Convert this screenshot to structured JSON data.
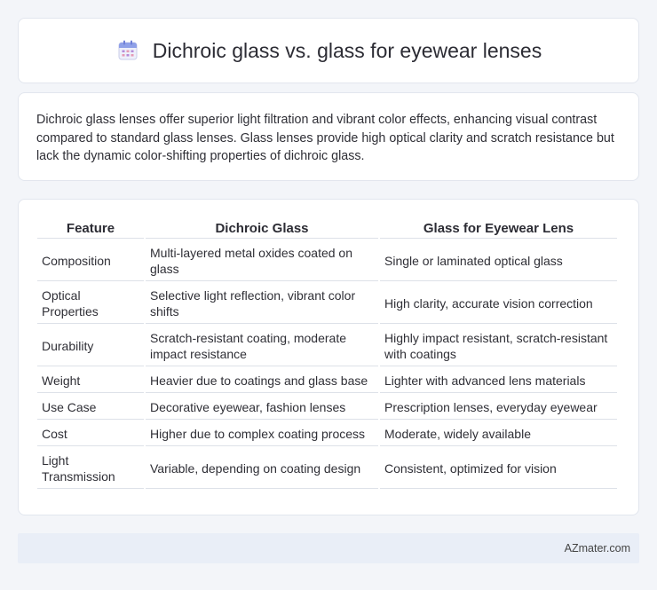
{
  "header": {
    "icon": "calendar-icon",
    "title": "Dichroic glass vs. glass for eyewear lenses"
  },
  "summary": "Dichroic glass lenses offer superior light filtration and vibrant color effects, enhancing visual contrast compared to standard glass lenses. Glass lenses provide high optical clarity and scratch resistance but lack the dynamic color-shifting properties of dichroic glass.",
  "table": {
    "headers": [
      "Feature",
      "Dichroic Glass",
      "Glass for Eyewear Lens"
    ],
    "rows": [
      [
        "Composition",
        "Multi-layered metal oxides coated on glass",
        "Single or laminated optical glass"
      ],
      [
        "Optical Properties",
        "Selective light reflection, vibrant color shifts",
        "High clarity, accurate vision correction"
      ],
      [
        "Durability",
        "Scratch-resistant coating, moderate impact resistance",
        "Highly impact resistant, scratch-resistant with coatings"
      ],
      [
        "Weight",
        "Heavier due to coatings and glass base",
        "Lighter with advanced lens materials"
      ],
      [
        "Use Case",
        "Decorative eyewear, fashion lenses",
        "Prescription lenses, everyday eyewear"
      ],
      [
        "Cost",
        "Higher due to complex coating process",
        "Moderate, widely available"
      ],
      [
        "Light Transmission",
        "Variable, depending on coating design",
        "Consistent, optimized for vision"
      ]
    ]
  },
  "footer": {
    "brand": "AZmater.com"
  }
}
